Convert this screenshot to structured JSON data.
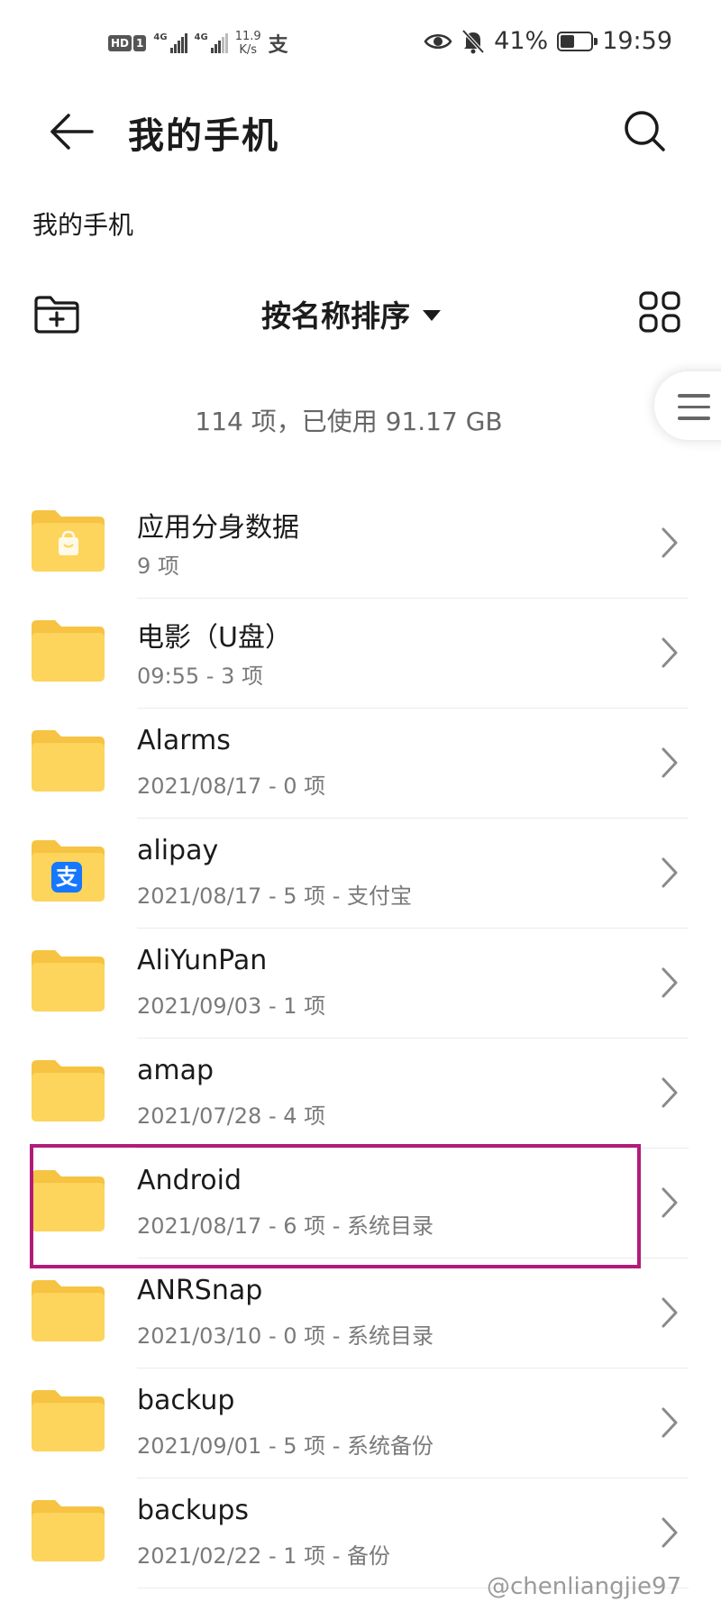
{
  "status_bar": {
    "hd_label": "HD",
    "sim_label": "1",
    "network_1": "4G",
    "network_2": "4G",
    "speed_value": "11.9",
    "speed_unit": "K/s",
    "alipay_glyph": "支",
    "battery_percent": "41%",
    "battery_level": 0.41,
    "time": "19:59",
    "icons": [
      "eye-icon",
      "bell-off-icon",
      "battery-icon"
    ]
  },
  "header": {
    "title": "我的手机",
    "back_icon": "arrow-left-icon",
    "search_icon": "search-icon"
  },
  "breadcrumb": "我的手机",
  "toolbar": {
    "sort_label": "按名称排序",
    "new_folder_icon": "folder-plus-icon",
    "view_icon": "grid-view-icon"
  },
  "summary": "114 项，已使用 91.17 GB",
  "files": [
    {
      "name": "应用分身数据",
      "meta": "9 项",
      "icon": "folder-bag-icon"
    },
    {
      "name": "电影（U盘）",
      "meta": "09:55 - 3 项",
      "icon": "folder-icon"
    },
    {
      "name": "Alarms",
      "meta": "2021/08/17 - 0 项",
      "icon": "folder-icon"
    },
    {
      "name": "alipay",
      "meta": "2021/08/17 - 5 项 - 支付宝",
      "icon": "folder-alipay-icon"
    },
    {
      "name": "AliYunPan",
      "meta": "2021/09/03 - 1 项",
      "icon": "folder-icon"
    },
    {
      "name": "amap",
      "meta": "2021/07/28 - 4 项",
      "icon": "folder-icon"
    },
    {
      "name": "Android",
      "meta": "2021/08/17 - 6 项 - 系统目录",
      "icon": "folder-icon",
      "highlighted": true
    },
    {
      "name": "ANRSnap",
      "meta": "2021/03/10 - 0 项 - 系统目录",
      "icon": "folder-icon"
    },
    {
      "name": "backup",
      "meta": "2021/09/01 - 5 项 - 系统备份",
      "icon": "folder-icon"
    },
    {
      "name": "backups",
      "meta": "2021/02/22 - 1 项 - 备份",
      "icon": "folder-icon"
    }
  ],
  "watermark": "@chenliangjie97",
  "colors": {
    "folder": "#fdd45c",
    "folder_tab": "#f6c342",
    "highlight": "#b21c79",
    "alipay_blue": "#1677ff"
  }
}
